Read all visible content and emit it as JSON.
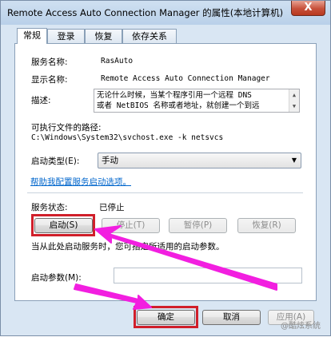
{
  "window": {
    "title": "Remote Access Auto Connection Manager 的属性(本地计算机)",
    "close_glyph": "X"
  },
  "tabs": [
    "常规",
    "登录",
    "恢复",
    "依存关系"
  ],
  "general": {
    "service_name_label": "服务名称:",
    "service_name": "RasAuto",
    "display_name_label": "显示名称:",
    "display_name": "Remote Access Auto Connection Manager",
    "description_label": "描述:",
    "description_lines": [
      "无论什么时候，当某个程序引用一个远程 DNS",
      "或者 NetBIOS 名称或者地址，就创建一个到远"
    ],
    "exe_path_label": "可执行文件的路径:",
    "exe_path": "C:\\Windows\\System32\\svchost.exe -k netsvcs",
    "startup_type_label": "启动类型(E):",
    "startup_type_value": "手动",
    "help_link": "帮助我配置服务启动选项。",
    "status_label": "服务状态:",
    "status_value": "已停止",
    "buttons": {
      "start": "启动(S)",
      "stop": "停止(T)",
      "pause": "暂停(P)",
      "resume": "恢复(R)"
    },
    "hint": "当从此处启动服务时，您可指定所适用的启动参数。",
    "params_label": "启动参数(M):",
    "params_value": ""
  },
  "footer": {
    "ok": "确定",
    "cancel": "取消",
    "apply": "应用(A)"
  },
  "watermark": "@酷炫系统",
  "colors": {
    "annotation_red": "#d01f2a",
    "annotation_arrow": "#f21fe0",
    "link": "#0066cc"
  }
}
